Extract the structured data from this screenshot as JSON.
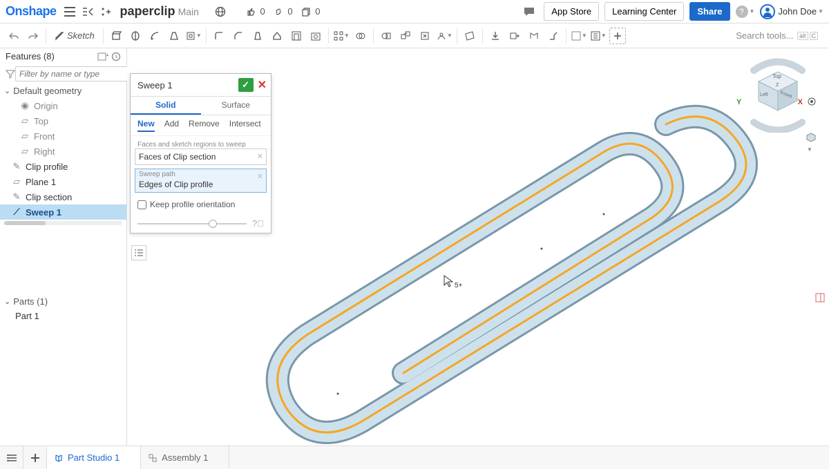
{
  "brand": "Onshape",
  "document": {
    "title": "paperclip",
    "branch": "Main"
  },
  "counters": {
    "thumbs": "0",
    "links": "0",
    "copies": "0"
  },
  "topbar": {
    "chat_icon": "chat-icon",
    "app_store": "App Store",
    "learning_center": "Learning Center",
    "share": "Share",
    "help": "?",
    "user_name": "John Doe"
  },
  "toolbar": {
    "sketch_label": "Sketch",
    "search_placeholder": "Search tools...",
    "kbd_alt": "alt",
    "kbd_c": "C"
  },
  "features": {
    "title": "Features (8)",
    "filter_placeholder": "Filter by name or type",
    "default_geometry": "Default geometry",
    "origin": "Origin",
    "top": "Top",
    "front": "Front",
    "right": "Right",
    "clip_profile": "Clip profile",
    "plane1": "Plane 1",
    "clip_section": "Clip section",
    "sweep1": "Sweep 1"
  },
  "parts": {
    "title": "Parts (1)",
    "part1": "Part 1"
  },
  "dialog": {
    "title": "Sweep 1",
    "tab_solid": "Solid",
    "tab_surface": "Surface",
    "op_new": "New",
    "op_add": "Add",
    "op_remove": "Remove",
    "op_intersect": "Intersect",
    "faces_label": "Faces and sketch regions to sweep",
    "faces_value": "Faces of Clip section",
    "path_label": "Sweep path",
    "path_value": "Edges of Clip profile",
    "keep_orientation": "Keep profile orientation"
  },
  "cursor_badge": "5+",
  "axes": {
    "y": "Y",
    "x": "X",
    "top": "Top",
    "front": "Front",
    "left": "Left",
    "z": "Z"
  },
  "bottom_tabs": {
    "part_studio": "Part Studio 1",
    "assembly": "Assembly 1"
  }
}
